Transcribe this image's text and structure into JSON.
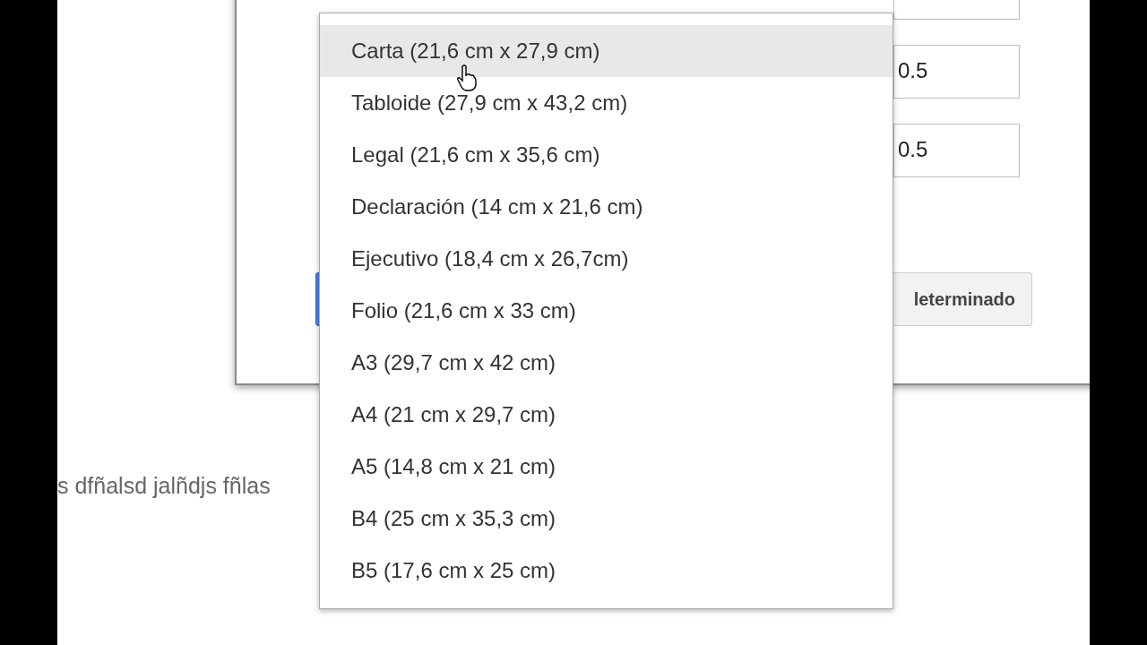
{
  "dialog": {
    "fields": [
      {
        "value": "0.5"
      },
      {
        "value": "0.5"
      }
    ],
    "buttons": [
      {
        "kind": "primary"
      },
      {
        "kind": "secondary",
        "label": "leterminado"
      }
    ]
  },
  "body_text": "s dfñalsd jalñdjs fñlas",
  "paper_size_menu": {
    "items": [
      {
        "label": "Carta (21,6 cm x 27,9 cm)",
        "selected": true
      },
      {
        "label": "Tabloide (27,9 cm x 43,2 cm)",
        "selected": false
      },
      {
        "label": "Legal (21,6 cm x 35,6 cm)",
        "selected": false
      },
      {
        "label": "Declaración (14 cm x 21,6 cm)",
        "selected": false
      },
      {
        "label": "Ejecutivo (18,4 cm x 26,7cm)",
        "selected": false
      },
      {
        "label": "Folio (21,6 cm x 33 cm)",
        "selected": false
      },
      {
        "label": "A3 (29,7 cm x 42 cm)",
        "selected": false
      },
      {
        "label": "A4 (21 cm x 29,7 cm)",
        "selected": false
      },
      {
        "label": "A5 (14,8 cm x 21 cm)",
        "selected": false
      },
      {
        "label": "B4 (25 cm x 35,3 cm)",
        "selected": false
      },
      {
        "label": "B5 (17,6 cm x 25 cm)",
        "selected": false
      }
    ]
  }
}
